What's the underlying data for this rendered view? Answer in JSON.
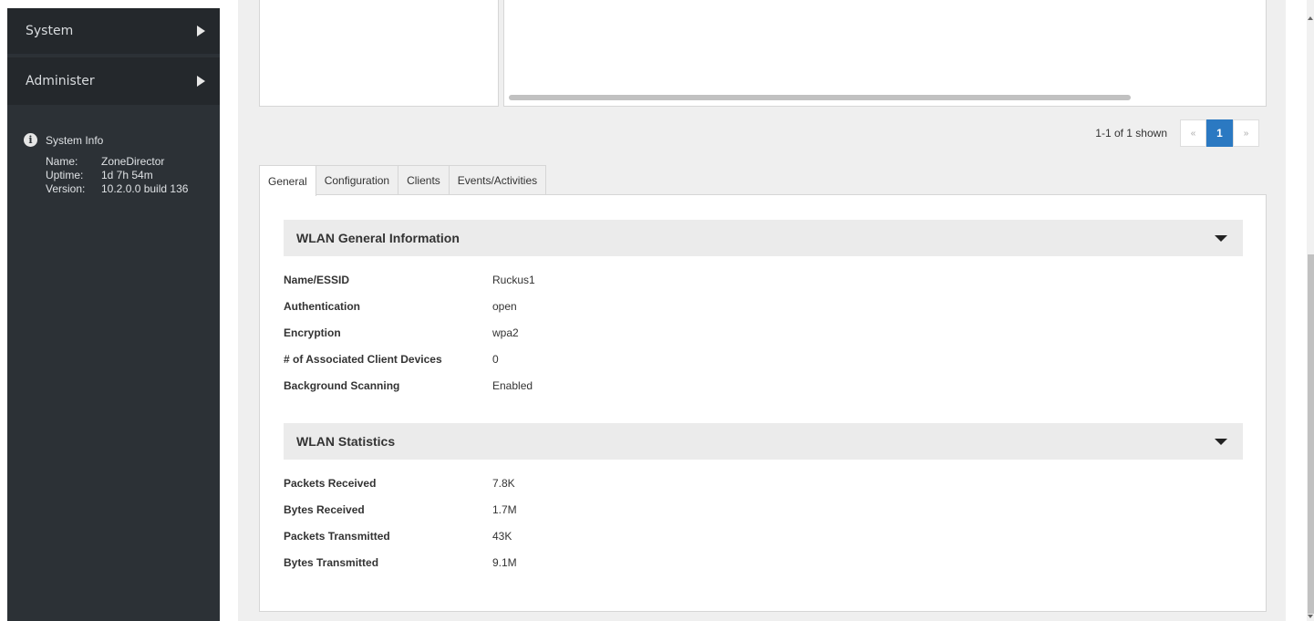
{
  "sidebar": {
    "nav": [
      {
        "label": "System"
      },
      {
        "label": "Administer"
      }
    ],
    "system_info": {
      "title": "System Info",
      "rows": [
        {
          "key": "Name:",
          "value": "ZoneDirector"
        },
        {
          "key": "Uptime:",
          "value": "1d 7h 54m"
        },
        {
          "key": "Version:",
          "value": "10.2.0.0 build 136"
        }
      ]
    }
  },
  "pagination": {
    "info": "1-1 of 1 shown",
    "prev": "«",
    "current": "1",
    "next": "»"
  },
  "tabs": [
    {
      "label": "General",
      "active": true
    },
    {
      "label": "Configuration",
      "active": false
    },
    {
      "label": "Clients",
      "active": false
    },
    {
      "label": "Events/Activities",
      "active": false
    }
  ],
  "general_info": {
    "title": "WLAN General Information",
    "rows": [
      {
        "key": "Name/ESSID",
        "value": "Ruckus1"
      },
      {
        "key": "Authentication",
        "value": "open"
      },
      {
        "key": "Encryption",
        "value": "wpa2"
      },
      {
        "key": "# of Associated Client Devices",
        "value": "0"
      },
      {
        "key": "Background Scanning",
        "value": "Enabled"
      }
    ]
  },
  "statistics": {
    "title": "WLAN Statistics",
    "rows": [
      {
        "key": "Packets Received",
        "value": "7.8K"
      },
      {
        "key": "Bytes Received",
        "value": "1.7M"
      },
      {
        "key": "Packets Transmitted",
        "value": "43K"
      },
      {
        "key": "Bytes Transmitted",
        "value": "9.1M"
      }
    ]
  },
  "colors": {
    "sidebar_bg": "#2c3136",
    "accent": "#2b79c2",
    "section_header_bg": "#ebebeb"
  }
}
